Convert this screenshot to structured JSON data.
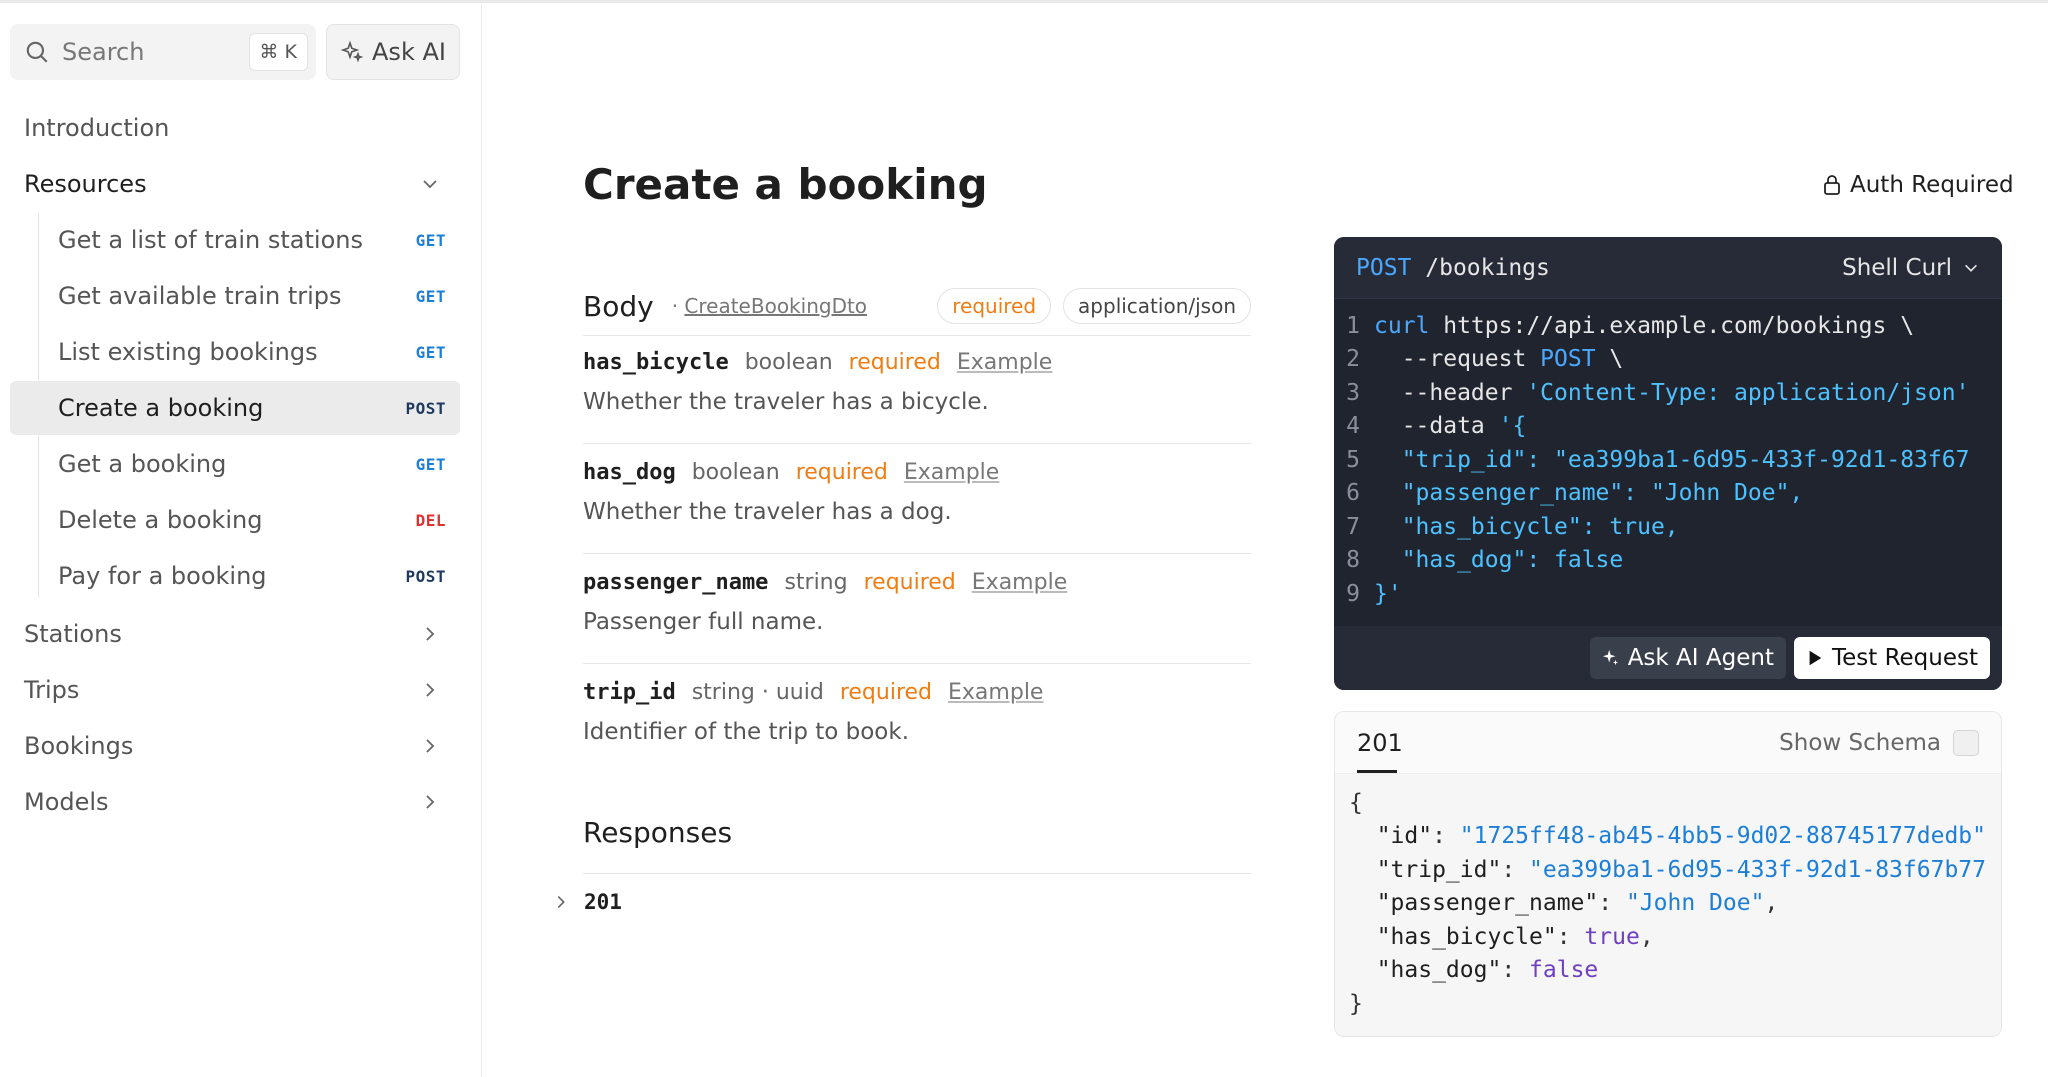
{
  "sidebar": {
    "search_placeholder": "Search",
    "search_shortcut": "⌘ K",
    "ask_ai_label": "Ask AI",
    "nav": {
      "introduction": "Introduction",
      "resources": "Resources",
      "stations": "Stations",
      "trips": "Trips",
      "bookings": "Bookings",
      "models": "Models"
    },
    "resources_items": [
      {
        "label": "Get a list of train stations",
        "method": "GET",
        "method_color": "#1c7ed6"
      },
      {
        "label": "Get available train trips",
        "method": "GET",
        "method_color": "#1c7ed6"
      },
      {
        "label": "List existing bookings",
        "method": "GET",
        "method_color": "#1c7ed6"
      },
      {
        "label": "Create a booking",
        "method": "POST",
        "method_color": "#1f3a5f"
      },
      {
        "label": "Get a booking",
        "method": "GET",
        "method_color": "#1c7ed6"
      },
      {
        "label": "Delete a booking",
        "method": "DEL",
        "method_color": "#e03131"
      },
      {
        "label": "Pay for a booking",
        "method": "POST",
        "method_color": "#1f3a5f"
      }
    ]
  },
  "main": {
    "title": "Create a booking",
    "auth_label": "Auth Required",
    "body": {
      "title": "Body",
      "dto_prefix": "·",
      "dto_name": "CreateBookingDto",
      "required_pill": "required",
      "mime_pill": "application/json"
    },
    "fields": [
      {
        "name": "has_bicycle",
        "type": "boolean",
        "required": "required",
        "example": "Example",
        "description": "Whether the traveler has a bicycle."
      },
      {
        "name": "has_dog",
        "type": "boolean",
        "required": "required",
        "example": "Example",
        "description": "Whether the traveler has a dog."
      },
      {
        "name": "passenger_name",
        "type": "string",
        "required": "required",
        "example": "Example",
        "description": "Passenger full name."
      },
      {
        "name": "trip_id",
        "type": "string · uuid",
        "required": "required",
        "example": "Example",
        "description": "Identifier of the trip to book."
      }
    ],
    "responses_title": "Responses",
    "response_code": "201"
  },
  "code_panel": {
    "method": "POST",
    "path": "/bookings",
    "language": "Shell Curl",
    "lines": [
      {
        "n": "1",
        "parts": [
          {
            "t": "curl",
            "c": "kw"
          },
          {
            "t": " https://api.example.com/bookings \\",
            "c": ""
          }
        ]
      },
      {
        "n": "2",
        "parts": [
          {
            "t": "  --request ",
            "c": ""
          },
          {
            "t": "POST",
            "c": "kw"
          },
          {
            "t": " \\",
            "c": ""
          }
        ]
      },
      {
        "n": "3",
        "parts": [
          {
            "t": "  --header ",
            "c": ""
          },
          {
            "t": "'Content-Type: application/json'",
            "c": "str"
          }
        ]
      },
      {
        "n": "4",
        "parts": [
          {
            "t": "  --data ",
            "c": ""
          },
          {
            "t": "'{",
            "c": "str"
          }
        ]
      },
      {
        "n": "5",
        "parts": [
          {
            "t": "  \"trip_id\": \"ea399ba1-6d95-433f-92d1-83f67",
            "c": "str"
          }
        ]
      },
      {
        "n": "6",
        "parts": [
          {
            "t": "  \"passenger_name\": \"John Doe\",",
            "c": "str"
          }
        ]
      },
      {
        "n": "7",
        "parts": [
          {
            "t": "  \"has_bicycle\": true,",
            "c": "str"
          }
        ]
      },
      {
        "n": "8",
        "parts": [
          {
            "t": "  \"has_dog\": false",
            "c": "str"
          }
        ]
      },
      {
        "n": "9",
        "parts": [
          {
            "t": "}'",
            "c": "str"
          }
        ]
      }
    ],
    "ask_agent_label": "Ask AI Agent",
    "test_request_label": "Test Request"
  },
  "response_panel": {
    "tab": "201",
    "show_schema_label": "Show Schema",
    "lines": [
      {
        "parts": [
          {
            "t": "{",
            "c": ""
          }
        ]
      },
      {
        "parts": [
          {
            "t": "  \"id\"",
            "c": "jkey"
          },
          {
            "t": ": ",
            "c": ""
          },
          {
            "t": "\"1725ff48-ab45-4bb5-9d02-88745177dedb\"",
            "c": "jstr"
          }
        ]
      },
      {
        "parts": [
          {
            "t": "  \"trip_id\"",
            "c": "jkey"
          },
          {
            "t": ": ",
            "c": ""
          },
          {
            "t": "\"ea399ba1-6d95-433f-92d1-83f67b77",
            "c": "jstr"
          }
        ]
      },
      {
        "parts": [
          {
            "t": "  \"passenger_name\"",
            "c": "jkey"
          },
          {
            "t": ": ",
            "c": ""
          },
          {
            "t": "\"John Doe\"",
            "c": "jstr"
          },
          {
            "t": ",",
            "c": ""
          }
        ]
      },
      {
        "parts": [
          {
            "t": "  \"has_bicycle\"",
            "c": "jkey"
          },
          {
            "t": ": ",
            "c": ""
          },
          {
            "t": "true",
            "c": "jbool"
          },
          {
            "t": ",",
            "c": ""
          }
        ]
      },
      {
        "parts": [
          {
            "t": "  \"has_dog\"",
            "c": "jkey"
          },
          {
            "t": ": ",
            "c": ""
          },
          {
            "t": "false",
            "c": "jbool"
          }
        ]
      },
      {
        "parts": [
          {
            "t": "}",
            "c": ""
          }
        ]
      }
    ]
  },
  "colors": {
    "accent_orange": "#f07d14",
    "get_blue": "#1c7ed6",
    "delete_red": "#e03131",
    "code_bg": "#20242f"
  }
}
